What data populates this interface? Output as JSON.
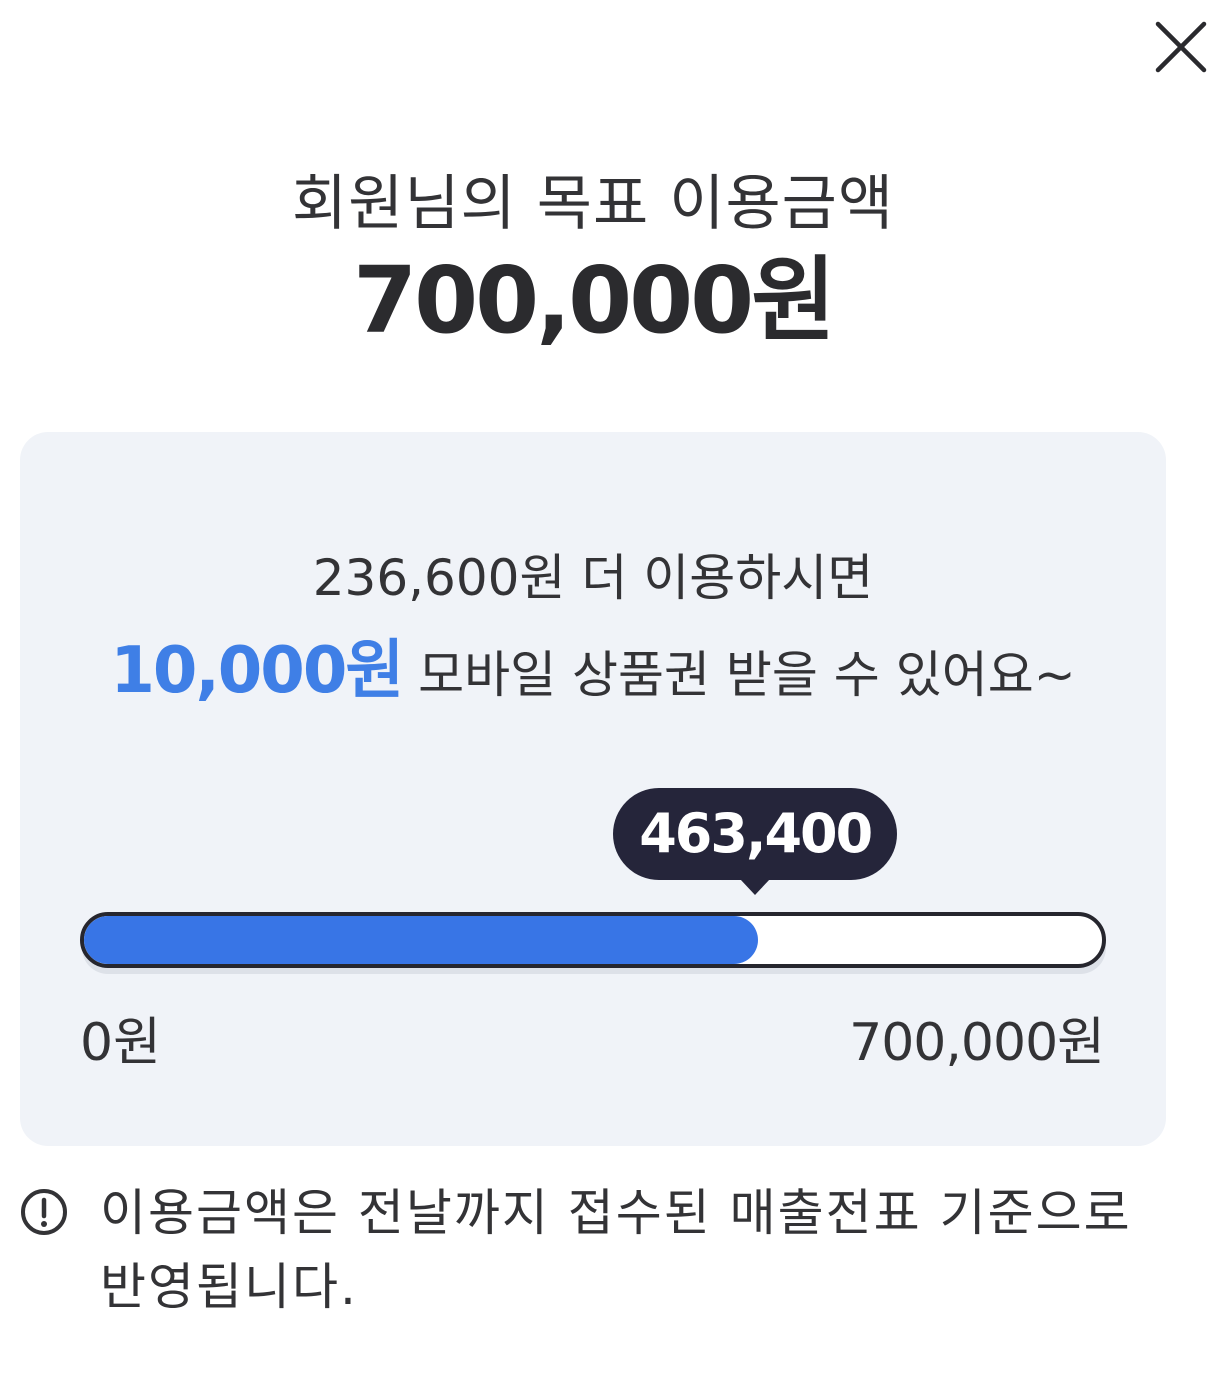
{
  "dialog": {
    "close_icon": "close-icon",
    "title": "회원님의 목표 이용금액",
    "target_amount": "700,000원"
  },
  "progress_card": {
    "message_line1": "236,600원 더 이용하시면",
    "reward_amount": "10,000원",
    "reward_text": " 모바일 상품권 받을 수 있어요~",
    "current_value_label": "463,400",
    "progress_fraction": 0.662,
    "min_label": "0원",
    "max_label": "700,000원",
    "fill_color": "#3875e6",
    "card_background": "#f0f3f8",
    "reward_color": "#3f7fe6"
  },
  "notice": {
    "icon": "exclamation-circle-icon",
    "text": "이용금액은 전날까지 접수된 매출전표 기준으로 반영됩니다."
  }
}
